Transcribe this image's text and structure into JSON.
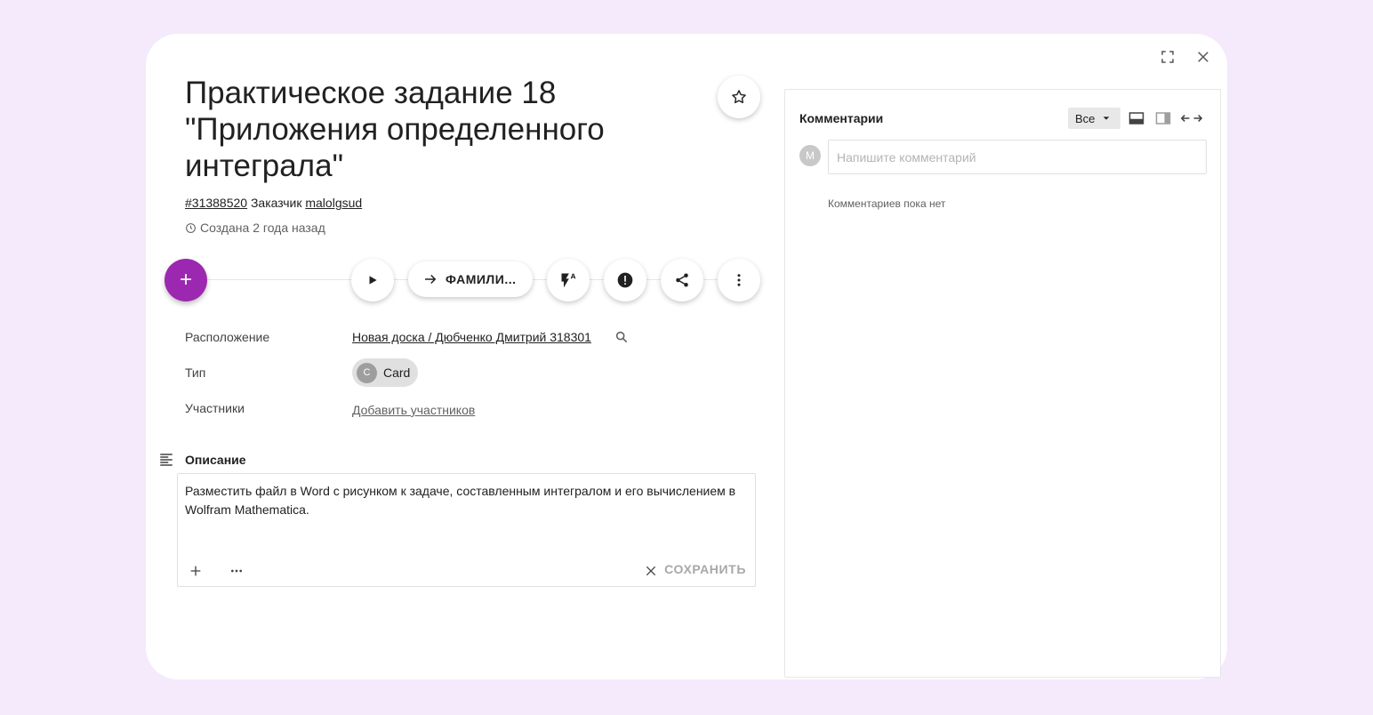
{
  "task": {
    "title": "Практическое задание 18\n\"Приложения определенного\nинтеграла\"",
    "id": "#31388520",
    "customer_label": "Заказчик",
    "customer_name": "malolgsud",
    "created": "Создана 2 года назад"
  },
  "actions": {
    "fab_label": "+",
    "move_label": "ФАМИЛИ..."
  },
  "properties": {
    "location_label": "Расположение",
    "location_value": "Новая доска / Дюбченко Дмитрий 318301",
    "type_label": "Тип",
    "type_avatar": "C",
    "type_value": "Card",
    "members_label": "Участники",
    "members_link": "Добавить участников"
  },
  "description": {
    "heading": "Описание",
    "text": "Разместить файл в Word с рисунком к задаче, составленным интегралом и его вычислением в Wolfram Mathematica.",
    "save_label": "СОХРАНИТЬ"
  },
  "comments": {
    "title": "Комментарии",
    "filter": "Все",
    "avatar": "M",
    "placeholder": "Напишите комментарий",
    "empty": "Комментариев пока нет"
  },
  "colors": {
    "background": "#f4eafc",
    "accent": "#9c27b0"
  }
}
